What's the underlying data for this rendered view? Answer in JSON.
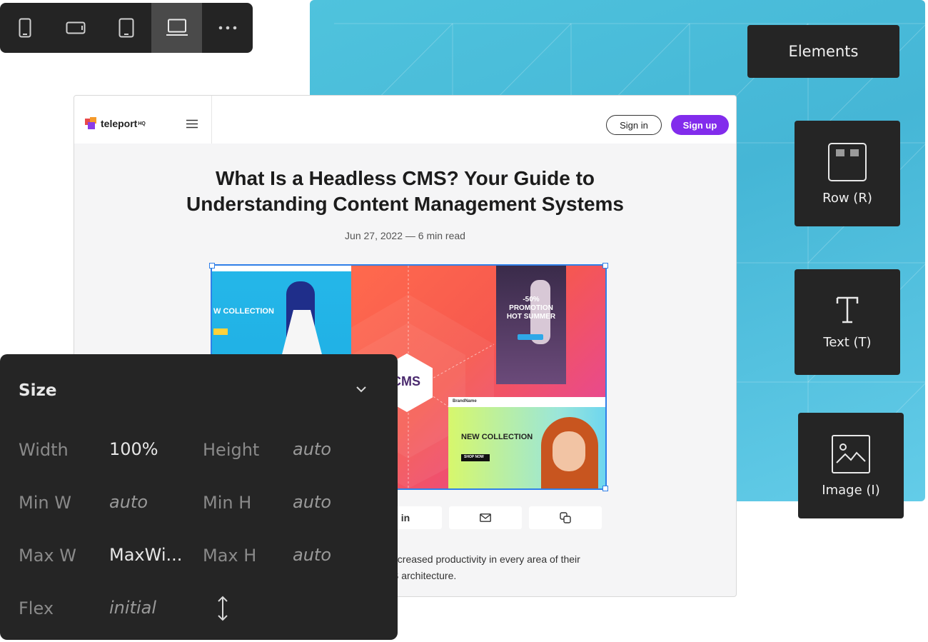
{
  "device_toolbar": {
    "devices": [
      {
        "icon": "mobile-portrait-icon"
      },
      {
        "icon": "mobile-landscape-icon"
      },
      {
        "icon": "tablet-icon"
      },
      {
        "icon": "laptop-icon",
        "active": true
      },
      {
        "icon": "more-icon"
      }
    ]
  },
  "elements_panel": {
    "title": "Elements",
    "items": [
      {
        "label": "Row (R)",
        "icon": "row-icon"
      },
      {
        "label": "Text (T)",
        "icon": "text-icon"
      },
      {
        "label": "Image (I)",
        "icon": "image-icon"
      }
    ]
  },
  "site": {
    "logo_text": "teleport",
    "logo_sup": "HQ",
    "signin": "Sign in",
    "signup": "Sign up",
    "title": "What Is a Headless CMS? Your Guide to Understanding Content Management Systems",
    "meta": "Jun 27, 2022  —  6 min read",
    "hero": {
      "left_text": "W COLLECTION",
      "promo_line1": "-50%",
      "promo_line2": "PROMOTION",
      "promo_line3": "HOT SUMMER",
      "cms": "CMS",
      "br_brand": "BrandName",
      "br_text": "NEW COLLECTION",
      "br_button": "SHOP NOW"
    },
    "share": {
      "linkedin": "in",
      "email": "email-icon",
      "copy": "copy-icon"
    },
    "body_line1": "ncreased productivity in every area of their",
    "body_line2": "S architecture."
  },
  "size_panel": {
    "title": "Size",
    "rows": [
      {
        "label1": "Width",
        "value1": "100%",
        "label2": "Height",
        "value2": "auto"
      },
      {
        "label1": "Min W",
        "value1": "auto",
        "label2": "Min H",
        "value2": "auto"
      },
      {
        "label1": "Max W",
        "value1": "MaxWi...",
        "label2": "Max H",
        "value2": "auto"
      },
      {
        "label1": "Flex",
        "value1": "initial"
      }
    ]
  },
  "colors": {
    "canvas_blue": "#45b6d6",
    "panel_dark": "#252525",
    "signup_purple": "#822cec",
    "selection_blue": "#2f7fe8"
  }
}
